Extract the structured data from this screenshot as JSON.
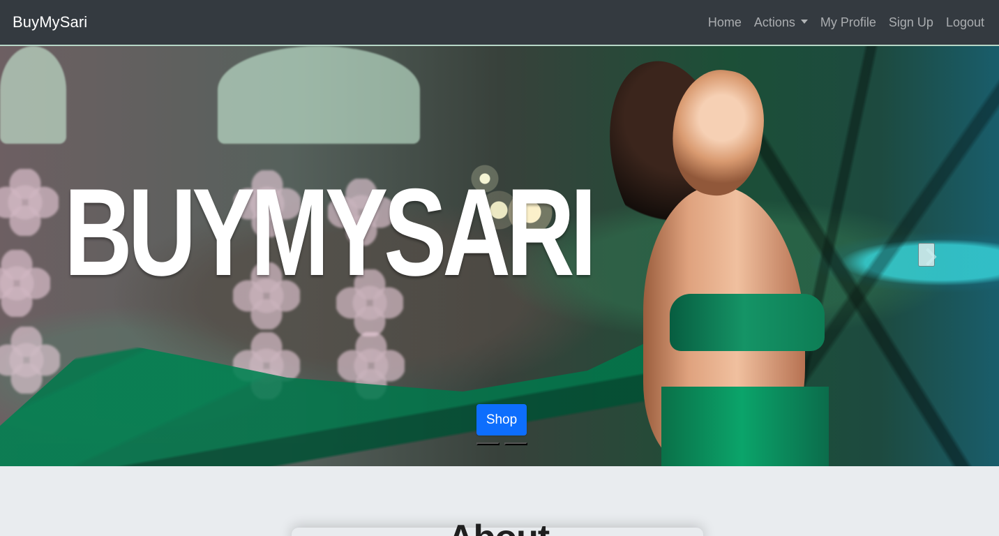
{
  "navbar": {
    "brand": "BuyMySari",
    "links": [
      {
        "label": "Home"
      },
      {
        "label": "Actions"
      },
      {
        "label": "My Profile"
      },
      {
        "label": "Sign Up"
      },
      {
        "label": "Logout"
      }
    ]
  },
  "hero": {
    "banner_text": "BUYMYSARI",
    "button_label": "Shop",
    "indicator_count": 2,
    "active_indicator": 1
  },
  "about": {
    "title": "About"
  },
  "colors": {
    "navbar": "#343a40",
    "primary_button": "#0d6efd",
    "page_background": "#e9ecef"
  },
  "icons": {
    "dropdown": "caret-down-icon",
    "carousel_next": "chevron-right-icon"
  }
}
